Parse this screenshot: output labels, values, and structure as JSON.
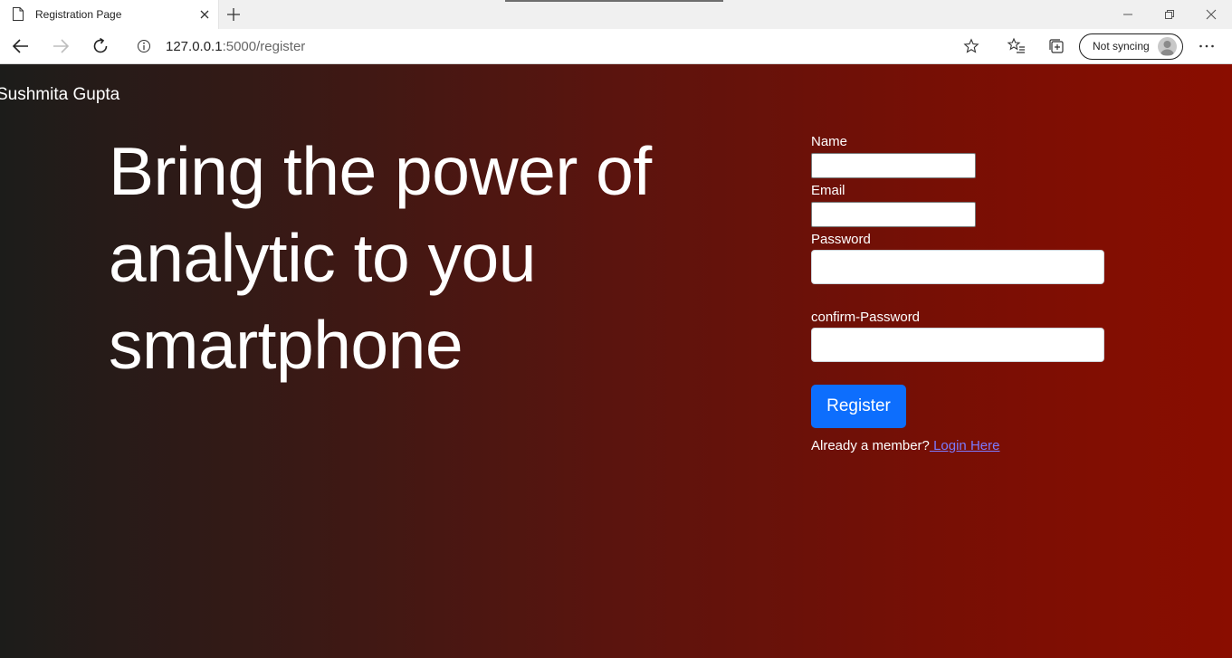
{
  "browser": {
    "tab_title": "Registration Page",
    "url_host": "127.0.0.1",
    "url_path": ":5000/register",
    "sync_label": "Not syncing"
  },
  "page": {
    "brand": "Sushmita Gupta",
    "hero_line1": "Bring the power of",
    "hero_line2": "analytic to you",
    "hero_line3": "smartphone",
    "form": {
      "name_label": "Name",
      "email_label": "Email",
      "password_label": "Password",
      "confirm_label": "confirm-Password",
      "register_label": "Register",
      "member_text": "Already a member?",
      "login_link": " Login Here"
    }
  },
  "colors": {
    "accent_button": "#0d6efd",
    "gradient_start": "#1c1c1a",
    "gradient_end": "#8a0d00"
  }
}
